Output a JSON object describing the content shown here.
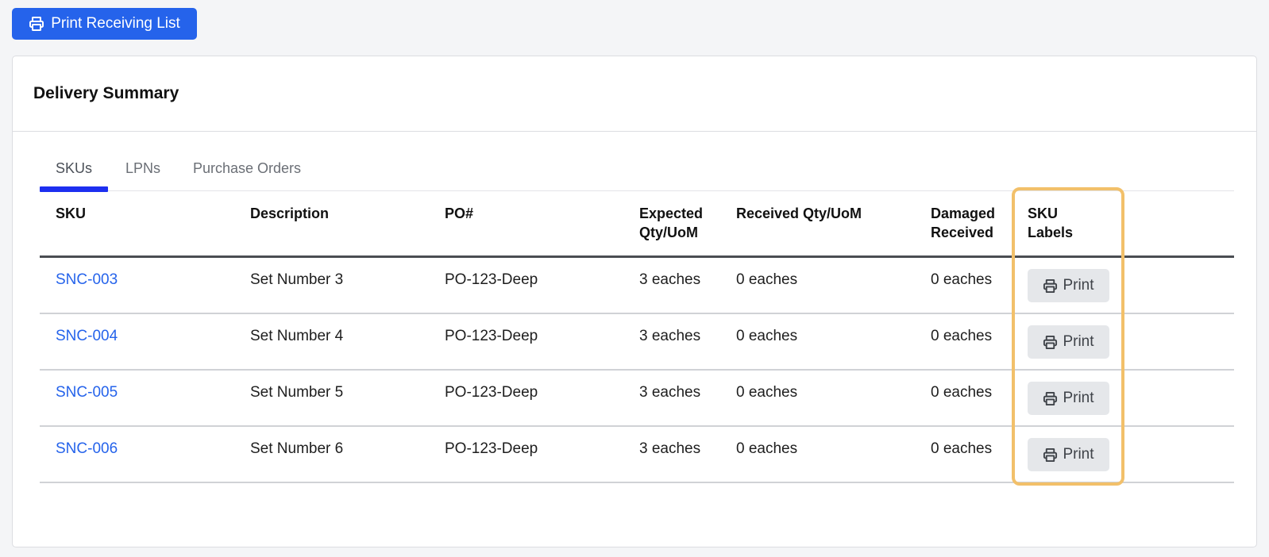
{
  "toolbar": {
    "print_receiving_list_label": "Print Receiving List",
    "icon": "printer-icon"
  },
  "card": {
    "title": "Delivery Summary"
  },
  "tabs": [
    {
      "label": "SKUs",
      "active": true
    },
    {
      "label": "LPNs",
      "active": false
    },
    {
      "label": "Purchase Orders",
      "active": false
    }
  ],
  "table": {
    "headers": {
      "sku": "SKU",
      "description": "Description",
      "po": "PO#",
      "expected_line1": "Expected",
      "expected_line2": "Qty/UoM",
      "received": "Received Qty/UoM",
      "damaged_line1": "Damaged",
      "damaged_line2": "Received",
      "labels_line1": "SKU",
      "labels_line2": "Labels"
    },
    "rows": [
      {
        "sku": "SNC-003",
        "description": "Set Number 3",
        "po": "PO-123-Deep",
        "expected": "3 eaches",
        "received": "0 eaches",
        "damaged": "0 eaches",
        "print_label": "Print"
      },
      {
        "sku": "SNC-004",
        "description": "Set Number 4",
        "po": "PO-123-Deep",
        "expected": "3 eaches",
        "received": "0 eaches",
        "damaged": "0 eaches",
        "print_label": "Print"
      },
      {
        "sku": "SNC-005",
        "description": "Set Number 5",
        "po": "PO-123-Deep",
        "expected": "3 eaches",
        "received": "0 eaches",
        "damaged": "0 eaches",
        "print_label": "Print"
      },
      {
        "sku": "SNC-006",
        "description": "Set Number 6",
        "po": "PO-123-Deep",
        "expected": "3 eaches",
        "received": "0 eaches",
        "damaged": "0 eaches",
        "print_label": "Print"
      }
    ]
  },
  "colors": {
    "primary_button": "#2563eb",
    "link": "#2563eb",
    "active_tab_indicator": "#1d2ff0",
    "highlight_outline": "#f2c06a",
    "secondary_button": "#e5e7ea"
  }
}
